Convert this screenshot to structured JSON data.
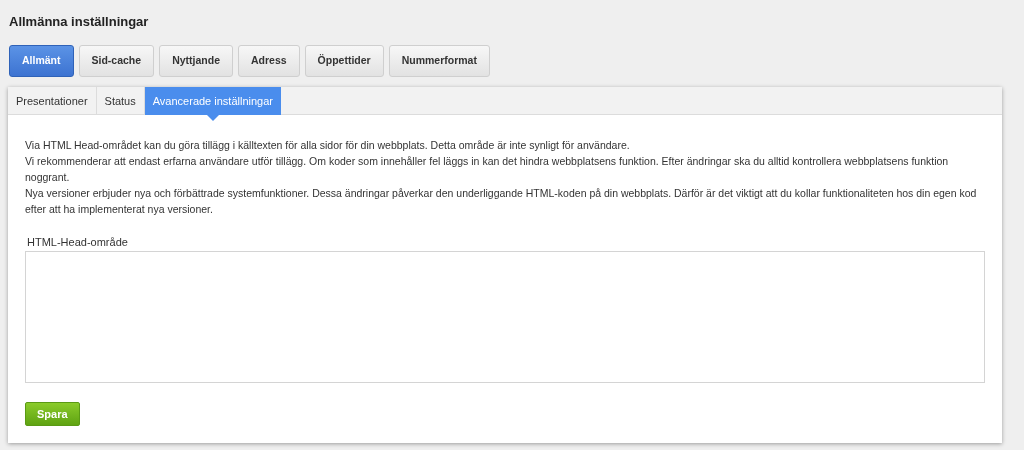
{
  "page_title": "Allmänna inställningar",
  "main_tabs": [
    {
      "label": "Allmänt",
      "selected": true
    },
    {
      "label": "Sid-cache",
      "selected": false
    },
    {
      "label": "Nyttjande",
      "selected": false
    },
    {
      "label": "Adress",
      "selected": false
    },
    {
      "label": "Öppettider",
      "selected": false
    },
    {
      "label": "Nummerformat",
      "selected": false
    }
  ],
  "sub_tabs": [
    {
      "label": "Presentationer",
      "selected": false
    },
    {
      "label": "Status",
      "selected": false
    },
    {
      "label": "Avancerade inställningar",
      "selected": true
    }
  ],
  "description": [
    "Via HTML Head-området kan du göra tillägg i källtexten för alla sidor för din webbplats. Detta område är inte synligt för användare.",
    "Vi rekommenderar att endast erfarna användare utför tillägg. Om koder som innehåller fel läggs in kan det hindra webbplatsens funktion. Efter ändringar ska du alltid kontrollera webbplatsens funktion noggrant.",
    "Nya versioner erbjuder nya och förbättrade systemfunktioner. Dessa ändringar påverkar den underliggande HTML-koden på din webbplats. Därför är det viktigt att du kollar funktionaliteten hos din egen kod efter att ha implementerat nya versioner."
  ],
  "head_field": {
    "label": "HTML-Head-område"
  },
  "save_button": "Spara"
}
